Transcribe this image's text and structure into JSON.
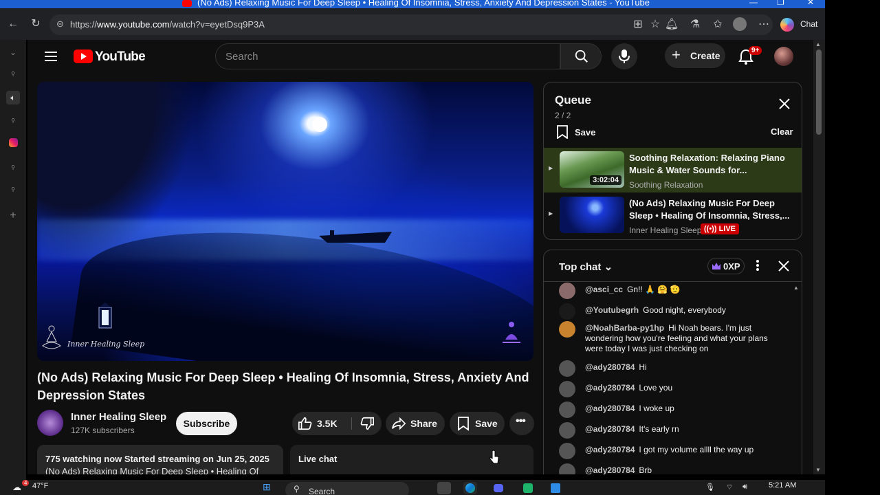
{
  "window": {
    "title": "(No Ads) Relaxing Music For Deep Sleep • Healing Of Insomnia, Stress, Anxiety And Depression States - YouTube"
  },
  "browser": {
    "url_prefix": "https://",
    "url_domain": "www.youtube.com",
    "url_path": "/watch?v=eyetDsq9P3A",
    "chat_label": "Chat"
  },
  "header": {
    "logo_text": "YouTube",
    "search_placeholder": "Search",
    "create_label": "Create",
    "notification_count": "9+"
  },
  "video": {
    "watermark": "Inner Healing Sleep",
    "title": "(No Ads) Relaxing Music For Deep Sleep • Healing Of Insomnia, Stress, Anxiety And Depression States",
    "channel_name": "Inner Healing Sleep",
    "subscribers": "127K subscribers",
    "subscribe_label": "Subscribe",
    "likes": "3.5K",
    "share_label": "Share",
    "save_label": "Save",
    "description_line1": "775 watching now  Started streaming on Jun 25, 2025",
    "description_line2": "(No Ads) Relaxing Music For Deep Sleep • Healing Of",
    "livechat_label": "Live chat"
  },
  "queue": {
    "title": "Queue",
    "position": "2 / 2",
    "save_label": "Save",
    "clear_label": "Clear",
    "items": [
      {
        "title": "Soothing Relaxation: Relaxing Piano Music & Water Sounds for...",
        "channel": "Soothing Relaxation",
        "duration": "3:02:04"
      },
      {
        "title": "(No Ads) Relaxing Music For Deep Sleep • Healing Of Insomnia, Stress,...",
        "channel": "Inner Healing Sleep",
        "badge": "LIVE"
      }
    ]
  },
  "chat": {
    "mode_label": "Top chat",
    "xp_label": "0XP",
    "messages": [
      {
        "author": "@asci_cc",
        "text": "Gn!! 🙏 🤗 🫡"
      },
      {
        "author": "@Youtubegrh",
        "text": "Good night, everybody"
      },
      {
        "author": "@NoahBarba-py1hp",
        "text": "Hi Noah bears. I'm just wondering how you're feeling and what your plans were today I was just checking on"
      },
      {
        "author": "@ady280784",
        "text": "Hi"
      },
      {
        "author": "@ady280784",
        "text": "Love you"
      },
      {
        "author": "@ady280784",
        "text": "I woke up"
      },
      {
        "author": "@ady280784",
        "text": "It's early rn"
      },
      {
        "author": "@ady280784",
        "text": "I got my volume allll the way up"
      },
      {
        "author": "@ady280784",
        "text": "Brb"
      }
    ]
  },
  "taskbar": {
    "weather_temp": "47°F",
    "weather_badge": "4",
    "search_label": "Search",
    "time": "5:21 AM"
  },
  "colors": {
    "youtube_red": "#ff0000",
    "live_red": "#cc0000",
    "queue_active_bg": "#2c3a17",
    "titlebar_blue": "#1b5fd1"
  }
}
